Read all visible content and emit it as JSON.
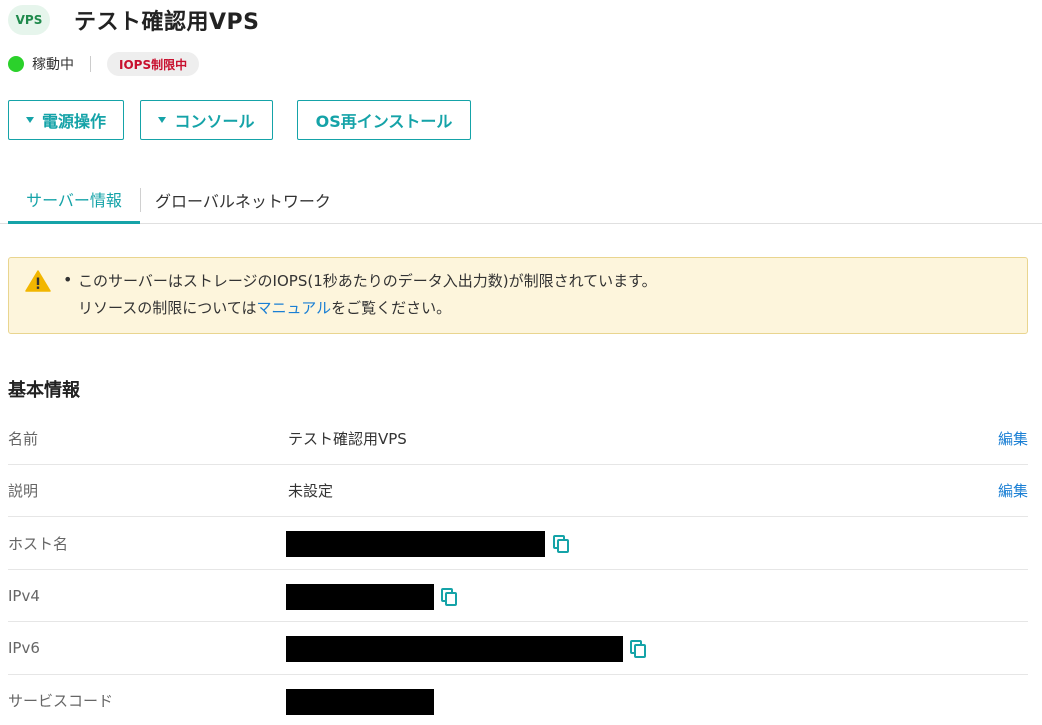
{
  "header": {
    "badge": "VPS",
    "title": "テスト確認用VPS"
  },
  "status": {
    "text": "稼動中",
    "badge": "IOPS制限中",
    "dot_color": "#2bd12b"
  },
  "actions": {
    "power": "電源操作",
    "console": "コンソール",
    "reinstall": "OS再インストール"
  },
  "tabs": [
    {
      "label": "サーバー情報",
      "active": true
    },
    {
      "label": "グローバルネットワーク",
      "active": false
    }
  ],
  "warning": {
    "line1": "このサーバーはストレージのIOPS(1秒あたりのデータ入出力数)が制限されています。",
    "line2_before": "リソースの制限については",
    "line2_link": "マニュアル",
    "line2_after": "をご覧ください。"
  },
  "basic_info": {
    "title": "基本情報",
    "edit_label": "編集",
    "rows": [
      {
        "label": "名前",
        "value": "テスト確認用VPS"
      },
      {
        "label": "説明",
        "value": "未設定"
      },
      {
        "label": "ホスト名"
      },
      {
        "label": "IPv4"
      },
      {
        "label": "IPv6"
      },
      {
        "label": "サービスコード"
      }
    ]
  },
  "colors": {
    "accent": "#15a3a8",
    "link": "#1a7fd4",
    "warning_bg": "#fdf5dc",
    "danger": "#c8102e"
  },
  "icons": {
    "warning": "warning-icon",
    "copy": "copy-icon",
    "caret": "caret-down-icon"
  }
}
